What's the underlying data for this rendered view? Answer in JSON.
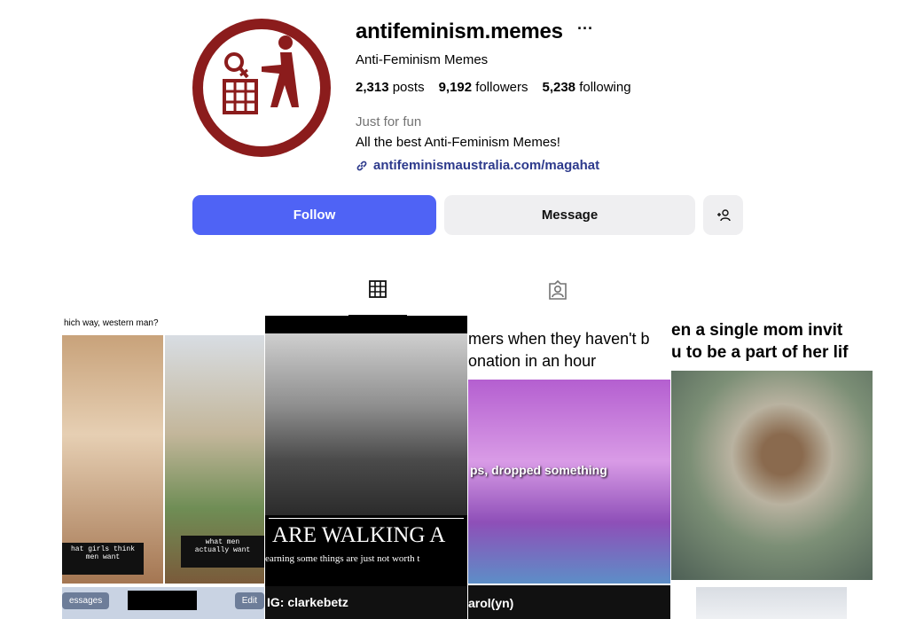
{
  "profile": {
    "username": "antifeminism.memes",
    "more_label": "···",
    "full_name": "Anti-Feminism Memes",
    "stats": {
      "posts_count": "2,313",
      "posts_label": "posts",
      "followers_count": "9,192",
      "followers_label": "followers",
      "following_count": "5,238",
      "following_label": "following"
    },
    "category": "Just for fun",
    "bio": "All the best Anti-Feminism Memes!",
    "link": "antifeminismaustralia.com/magahat",
    "avatar_color": "#8b1c1c"
  },
  "actions": {
    "follow_label": "Follow",
    "message_label": "Message",
    "follow_color": "#4f63f5"
  },
  "tabs": [
    {
      "icon": "grid-icon",
      "active": true
    },
    {
      "icon": "tagged-icon",
      "active": false
    }
  ],
  "posts": [
    {
      "caption": "hich way, western man?",
      "left_label": "hat girls think\nmen want",
      "right_label": "what men\nactually want",
      "footer_left": "essages",
      "footer_right": "Edit"
    },
    {
      "headline": "ARE WALKING A",
      "subline": "earning some things are just not worth t",
      "footer": "IG: clarkebetz"
    },
    {
      "caption_line1": "mers when they haven't b",
      "caption_line2": "onation in an hour",
      "overlay": "ps, dropped something",
      "footer": "arol(yn)"
    },
    {
      "caption_line1": "en a single mom invit",
      "caption_line2": "u to be a part of her lif"
    }
  ]
}
